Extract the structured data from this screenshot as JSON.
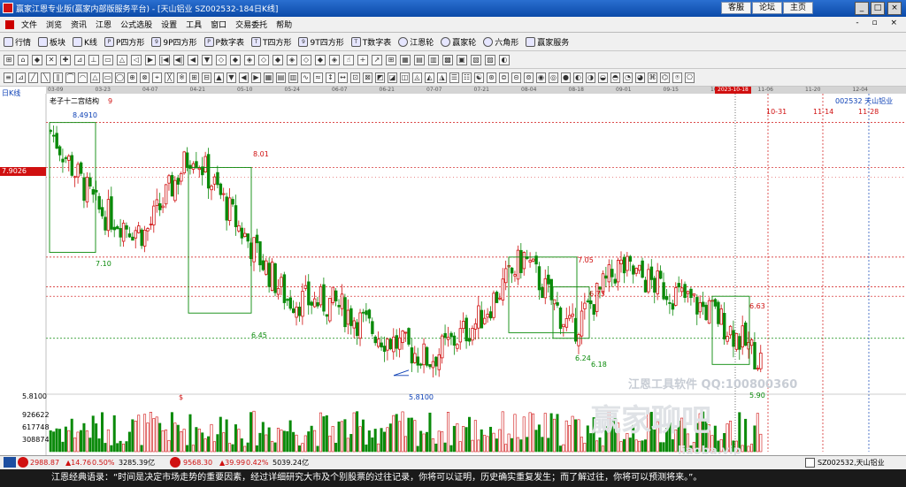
{
  "window": {
    "title": "赢家江恩专业版(赢家内部版服务平台) - [天山铝业  SZ002532-184日K线]",
    "top_links": [
      "客服",
      "论坛",
      "主页"
    ],
    "controls": [
      "_",
      "□",
      "×"
    ]
  },
  "menu": [
    "文件",
    "浏览",
    "资讯",
    "江恩",
    "公式选股",
    "设置",
    "工具",
    "窗口",
    "交易委托",
    "帮助"
  ],
  "toolbar_main": [
    "行情",
    "板块",
    "K线",
    "P四方形",
    "9P四方形",
    "P数字表",
    "T四方形",
    "9T四方形",
    "T数字表",
    "江恩轮",
    "赢家轮",
    "六角形",
    "赢家服务"
  ],
  "chart": {
    "period": "日K线",
    "code_name": "002532  天山铝业",
    "indicator_label": "老子十二宫结构",
    "price_tag": "7.9026",
    "current_date": "2023-10-18",
    "dates": [
      "03-09",
      "03-23",
      "04-07",
      "04-21",
      "05-10",
      "05-24",
      "06-07",
      "06-21",
      "07-07",
      "07-21",
      "08-04",
      "08-18",
      "09-01",
      "09-15",
      "10-09",
      "11-06",
      "11-20",
      "12-04"
    ],
    "future_dates": [
      "10-31",
      "11-14",
      "11-28"
    ],
    "price_labels": [
      "8.4910",
      "7.10",
      "8.01",
      "6.45",
      "5.8100",
      "7.05",
      "6.73",
      "6.24",
      "6.18",
      "6.63",
      "5.90",
      "9"
    ],
    "vol_labels": [
      "5.8100",
      "926622",
      "617748",
      "308874"
    ],
    "vol_marker": "$"
  },
  "chart_data": {
    "type": "candlestick",
    "title": "天山铝业 002532 日K线",
    "x": [
      "03-09",
      "03-23",
      "04-07",
      "04-21",
      "05-10",
      "05-24",
      "06-07",
      "06-21",
      "07-07",
      "07-21",
      "08-04",
      "08-18",
      "09-01",
      "09-15",
      "10-09",
      "10-18"
    ],
    "close": [
      8.4,
      7.55,
      7.3,
      8.2,
      7.35,
      6.6,
      6.55,
      6.2,
      5.95,
      6.35,
      7.05,
      6.25,
      6.95,
      6.7,
      6.45,
      5.95
    ],
    "annotations": [
      {
        "label": "8.4910",
        "value": 8.491
      },
      {
        "label": "7.10",
        "value": 7.1
      },
      {
        "label": "8.01",
        "value": 8.01
      },
      {
        "label": "6.45",
        "value": 6.45
      },
      {
        "label": "5.8100",
        "value": 5.81
      },
      {
        "label": "7.05",
        "value": 7.05
      },
      {
        "label": "6.73",
        "value": 6.73
      },
      {
        "label": "6.24",
        "value": 6.24
      },
      {
        "label": "6.18",
        "value": 6.18
      },
      {
        "label": "6.63",
        "value": 6.63
      },
      {
        "label": "5.90",
        "value": 5.9
      }
    ],
    "volume_ticks": [
      308874,
      617748,
      926622
    ],
    "ylim": [
      5.6,
      8.8
    ]
  },
  "watermark": {
    "line1": "江恩工具软件  QQ:100800360",
    "line2": "赢家聊吧",
    "line3": "liaoba.vip"
  },
  "status": {
    "sh_index": "2988.87",
    "sh_change": "▲14.76",
    "sh_pct": "0.50%",
    "sh_amount": "3285.39亿",
    "sz_index": "9568.30",
    "sz_change": "▲39.99",
    "sz_pct": "0.42%",
    "sz_amount": "5039.24亿",
    "stock": "SZ002532,天山铝业"
  },
  "quote": "江恩经典语录：“时间是决定市场走势的重要因素，经过详细研究大市及个别股票的过往记录，你将可以证明，历史确实重复发生；而了解过往，你将可以预测将来。”。",
  "colors": {
    "up": "#d01010",
    "down": "#0a8a0a",
    "box": "#0a8a0a",
    "dash": "#d01010"
  }
}
